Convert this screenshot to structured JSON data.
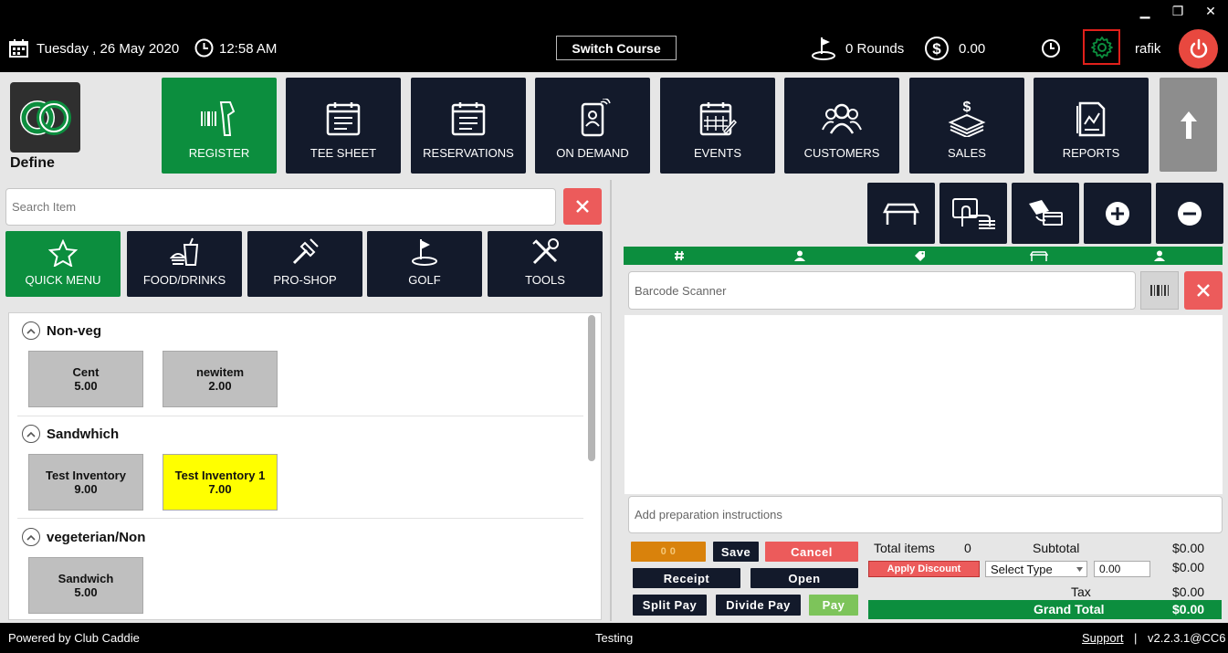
{
  "topbar": {
    "date": "Tuesday ,  26 May 2020",
    "time": "12:58 AM",
    "switch_course_label": "Switch Course",
    "rounds": "0 Rounds",
    "balance": "0.00",
    "user": "rafik",
    "window_controls": {
      "minimize": "▁",
      "restore": "❐",
      "close": "✕"
    }
  },
  "brand": {
    "name": "Define"
  },
  "nav": {
    "items": [
      {
        "label": "REGISTER",
        "icon": "barcode-scanner-icon",
        "active": true
      },
      {
        "label": "TEE SHEET",
        "icon": "tee-sheet-icon"
      },
      {
        "label": "RESERVATIONS",
        "icon": "calendar-icon"
      },
      {
        "label": "ON DEMAND",
        "icon": "mobile-user-icon"
      },
      {
        "label": "EVENTS",
        "icon": "event-calendar-icon"
      },
      {
        "label": "CUSTOMERS",
        "icon": "customers-icon"
      },
      {
        "label": "SALES",
        "icon": "sales-icon"
      },
      {
        "label": "REPORTS",
        "icon": "reports-icon"
      }
    ]
  },
  "search": {
    "placeholder": "Search Item"
  },
  "categories": [
    {
      "label": "QUICK MENU",
      "active": true
    },
    {
      "label": "FOOD/DRINKS"
    },
    {
      "label": "PRO-SHOP"
    },
    {
      "label": "GOLF"
    },
    {
      "label": "TOOLS"
    }
  ],
  "groups": [
    {
      "name": "Non-veg",
      "items": [
        {
          "name": "Cent",
          "price": "5.00"
        },
        {
          "name": "newitem",
          "price": "2.00"
        }
      ]
    },
    {
      "name": "Sandwhich",
      "items": [
        {
          "name": "Test Inventory",
          "price": "9.00"
        },
        {
          "name": "Test Inventory 1",
          "price": "7.00",
          "highlight": "#ffff00"
        }
      ]
    },
    {
      "name": "vegeterian/Non",
      "items": [
        {
          "name": "Sandwich",
          "price": "5.00"
        }
      ]
    }
  ],
  "cart": {
    "columns_icons": [
      "hash-icon",
      "person-icon",
      "tag-icon",
      "cart-icon",
      "user-icon"
    ],
    "barcode_placeholder": "Barcode Scanner",
    "prep_placeholder": "Add preparation instructions"
  },
  "actions": {
    "counter": "0   0",
    "save": "Save",
    "cancel": "Cancel",
    "receipt": "Receipt",
    "open": "Open",
    "split_pay": "Split Pay",
    "divide_pay": "Divide Pay",
    "pay": "Pay"
  },
  "totals": {
    "total_items_label": "Total items",
    "total_items": "0",
    "subtotal_label": "Subtotal",
    "subtotal": "$0.00",
    "apply_discount": "Apply Discount",
    "select_type": "Select Type",
    "discount_value": "0.00",
    "discount_amount": "$0.00",
    "tax_label": "Tax",
    "tax": "$0.00",
    "grand_total_label": "Grand Total",
    "grand_total": "$0.00"
  },
  "footer": {
    "powered": "Powered by Club Caddie",
    "env": "Testing",
    "support": "Support",
    "sep": "|",
    "version": "v2.2.3.1@CC6"
  },
  "colors": {
    "green": "#0c8e3e",
    "navy": "#131a2b",
    "red": "#ec5b5b",
    "highlight": "#ffff00"
  }
}
